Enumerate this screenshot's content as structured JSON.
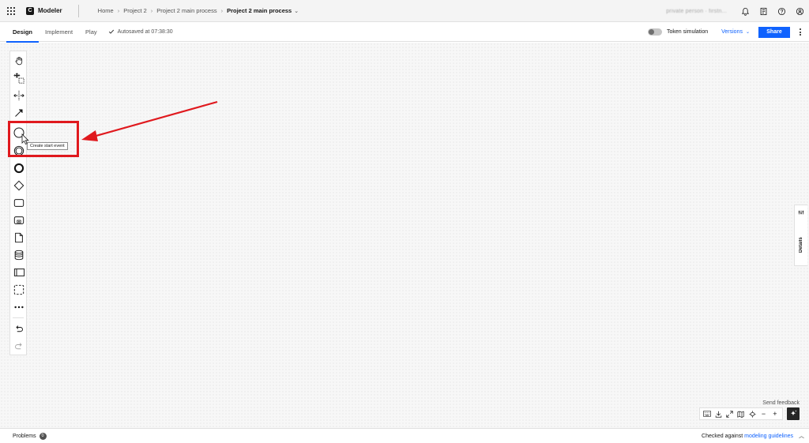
{
  "header": {
    "brand_name": "Modeler",
    "brand_logo": "C",
    "breadcrumb": [
      "Home",
      "Project 2",
      "Project 2 main process"
    ],
    "breadcrumb_current": "Project 2 main process",
    "user_name": "private person · firstn...",
    "icons": [
      "notification-icon",
      "documentation-icon",
      "help-icon",
      "user-icon"
    ]
  },
  "subheader": {
    "tabs": [
      "Design",
      "Implement",
      "Play"
    ],
    "active_tab": "Design",
    "autosave_text": "Autosaved at 07:38:30",
    "token_simulation_label": "Token simulation",
    "versions_label": "Versions",
    "share_label": "Share"
  },
  "palette": {
    "tools": [
      "hand-tool-icon",
      "lasso-tool-icon",
      "space-tool-icon",
      "connect-tool-icon",
      "start-event-icon",
      "intermediate-event-icon",
      "end-event-icon",
      "gateway-icon",
      "task-icon",
      "subprocess-icon",
      "data-object-icon",
      "data-store-icon",
      "pool-icon",
      "group-icon",
      "more-icon",
      "undo-icon",
      "redo-icon"
    ]
  },
  "tooltip": {
    "text": "Create start event"
  },
  "details_panel": {
    "label": "Details"
  },
  "canvas_controls": {
    "send_feedback": "Send feedback",
    "zoom_out": "−",
    "zoom_in": "+"
  },
  "statusbar": {
    "problems_label": "Problems",
    "problems_count": "0",
    "checked_prefix": "Checked against ",
    "checked_link": "modeling guidelines"
  },
  "colors": {
    "accent": "#0f62fe",
    "annotation": "#e0191e"
  }
}
